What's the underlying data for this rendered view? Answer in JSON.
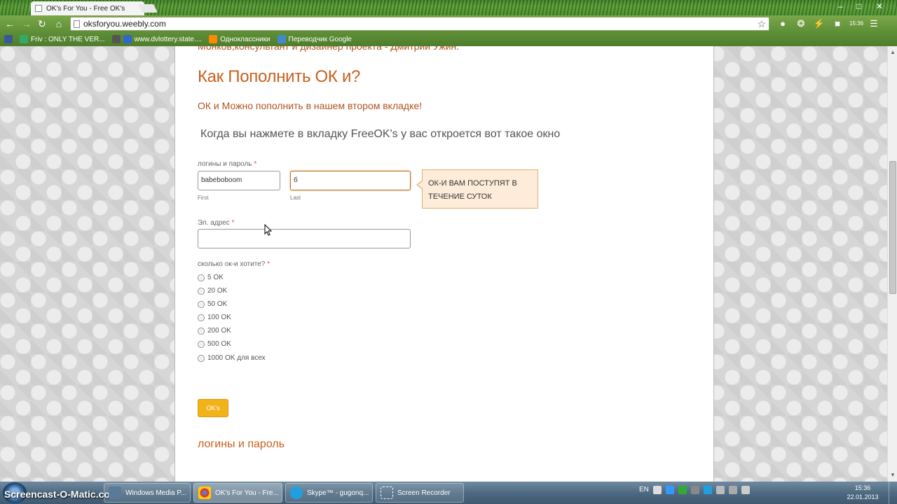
{
  "browser": {
    "tab_title": "OK's For You - Free OK's",
    "url": "oksforyou.weebly.com",
    "badge": "15:36",
    "bookmarks": [
      {
        "label": "Friv : ONLY THE VER...",
        "color": "#3a6"
      },
      {
        "label": "www.dvlottery.state....",
        "color": "#36c"
      },
      {
        "label": "Одноклассники",
        "color": "#f80"
      },
      {
        "label": "Переводчик Google",
        "color": "#48c"
      }
    ]
  },
  "page": {
    "cut_text": "Монков,консультант и дизайнер проекта - Дмитрий Ужин.",
    "heading": "Как Пополнить ОК и?",
    "subheading": "ОК и Можно пополнить в нашем втором вкладке!",
    "paragraph": "Когда вы нажмете в вкладку FreeOK's у вас откроется вот такое окно",
    "form": {
      "login_label": "логины и пароль",
      "required_mark": "*",
      "first_value": "babeboboom",
      "first_sublabel": "First",
      "last_value": "б",
      "last_sublabel": "Last",
      "tooltip": "ОК-И ВАМ ПОСТУПЯТ В ТЕЧЕНИЕ СУТОК",
      "email_label": "Эл. адрес",
      "email_value": "",
      "question_label": "сколько ок-и хотите?",
      "options": [
        "5 OK",
        "20 OK",
        "50 OK",
        "100 OK",
        "200 OK",
        "500 OK",
        "1000 OK для всех"
      ],
      "submit_label": "OK's"
    },
    "heading2": "логины и пароль"
  },
  "taskbar": {
    "watermark": "Screencast-O-Matic.com",
    "items": [
      {
        "label": "Windows Media P...",
        "active": false
      },
      {
        "label": "OK's For You - Fre...",
        "active": true
      },
      {
        "label": "Skype™ - gugonq...",
        "active": false
      },
      {
        "label": "Screen Recorder",
        "active": false
      }
    ],
    "language": "EN",
    "time": "15:36",
    "date": "22.01.2013"
  },
  "colors": {
    "accent": "#c8601e",
    "button": "#f2b21a",
    "tooltip_bg": "#fcecd9"
  }
}
